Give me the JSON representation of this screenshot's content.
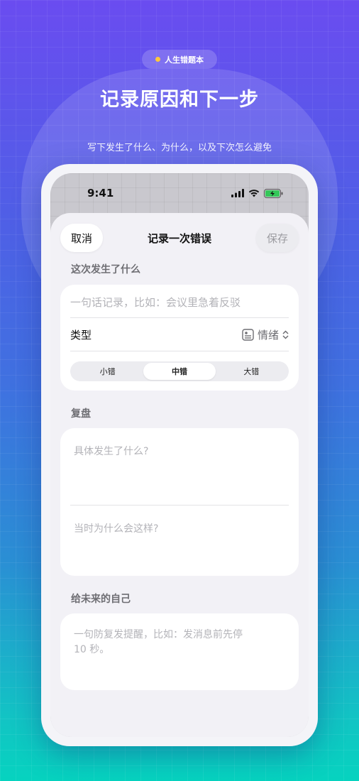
{
  "banner": {
    "pill_label": "人生错题本",
    "headline": "记录原因和下一步",
    "subline": "写下发生了什么、为什么，以及下次怎么避免"
  },
  "status_bar": {
    "time": "9:41",
    "icons": [
      "signal-icon",
      "wifi-icon",
      "battery-charging-icon"
    ]
  },
  "nav": {
    "cancel_label": "取消",
    "title": "记录一次错误",
    "save_label": "保存"
  },
  "what_happened": {
    "section_label": "这次发生了什么",
    "summary_placeholder": "一句话记录，比如：会议里急着反驳",
    "type_label": "类型",
    "type_value": "情绪",
    "type_icon": "note-card-icon",
    "severity_options": [
      "小错",
      "中错",
      "大错"
    ],
    "severity_selected": "中错"
  },
  "review": {
    "section_label": "复盘",
    "what_placeholder": "具体发生了什么?",
    "why_placeholder": "当时为什么会这样?"
  },
  "future_self": {
    "section_label": "给未来的自己",
    "reminder_placeholder": "一句防复发提醒，比如：发消息前先停 10 秒。"
  },
  "colors": {
    "accent_yellow": "#ffc83d",
    "battery_green": "#34c759",
    "gradient_top": "#6a4cf0",
    "gradient_bottom": "#06d3bf"
  }
}
